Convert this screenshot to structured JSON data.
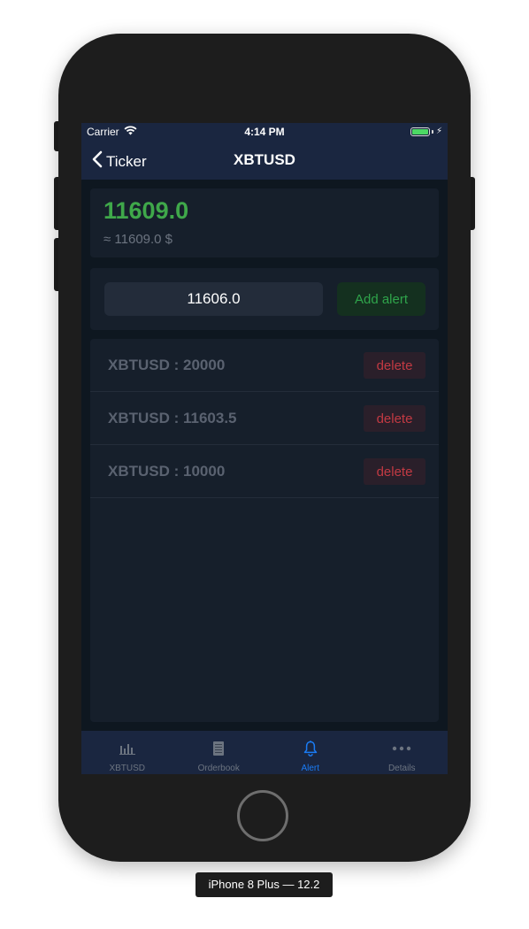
{
  "status_bar": {
    "carrier": "Carrier",
    "time": "4:14 PM"
  },
  "nav": {
    "back_label": "Ticker",
    "title": "XBTUSD"
  },
  "price": {
    "value": "11609.0",
    "approx": "≈ 11609.0 $",
    "color": "#3fa84a"
  },
  "alert_form": {
    "input_value": "11606.0",
    "add_button_label": "Add alert"
  },
  "alerts": [
    {
      "label": "XBTUSD : 20000",
      "delete_label": "delete"
    },
    {
      "label": "XBTUSD : 11603.5",
      "delete_label": "delete"
    },
    {
      "label": "XBTUSD : 10000",
      "delete_label": "delete"
    }
  ],
  "tabs": [
    {
      "label": "XBTUSD",
      "icon": "chart-bars-icon",
      "active": false
    },
    {
      "label": "Orderbook",
      "icon": "document-icon",
      "active": false
    },
    {
      "label": "Alert",
      "icon": "bell-icon",
      "active": true
    },
    {
      "label": "Details",
      "icon": "ellipsis-icon",
      "active": false
    }
  ],
  "device_label": "iPhone 8 Plus — 12.2",
  "colors": {
    "accent_blue": "#1a7cf5",
    "price_green": "#3fa84a",
    "delete_red": "#c23a43",
    "nav_background": "#1a2640"
  }
}
